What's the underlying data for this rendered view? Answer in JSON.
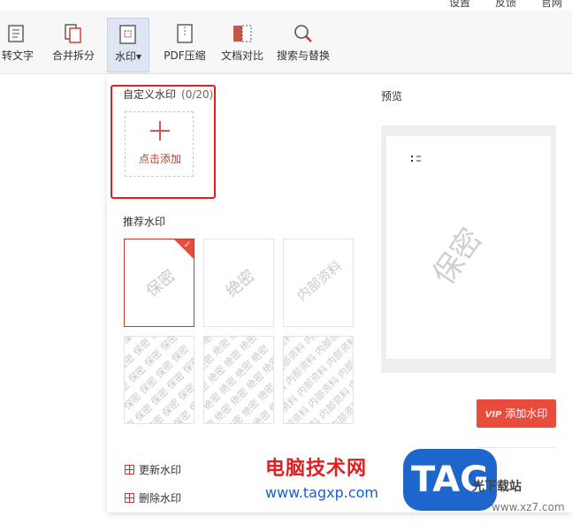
{
  "topbar": {
    "items": [
      "设置",
      "反馈",
      "官网"
    ]
  },
  "toolbar": {
    "items": [
      {
        "label": "转文字",
        "icon": "document-text-icon"
      },
      {
        "label": "合并拆分",
        "icon": "merge-split-icon"
      },
      {
        "label": "水印▾",
        "icon": "watermark-icon"
      },
      {
        "label": "PDF压缩",
        "icon": "compress-icon"
      },
      {
        "label": "文档对比",
        "icon": "compare-icon"
      },
      {
        "label": "搜索与替换",
        "icon": "search-icon"
      }
    ],
    "active_index": 2
  },
  "custom": {
    "title": "自定义水印",
    "count": "(0/20)",
    "add_label": "点击添加"
  },
  "recommended": {
    "title": "推荐水印",
    "tiles_single": [
      "保密",
      "绝密",
      "内部资料"
    ],
    "tiles_tiled": [
      "保密",
      "绝密",
      "内部资料"
    ]
  },
  "preview": {
    "title": "预览",
    "watermark": "保密"
  },
  "buttons": {
    "add_watermark": "添加水印",
    "vip": "VIP"
  },
  "actions": {
    "update": "更新水印",
    "delete": "删除水印"
  },
  "overlay": {
    "site_cn": "电脑技术网",
    "site_url": "www.tagxp.com",
    "tag": "TAG",
    "xz_cn": "光下载站",
    "xz_url": "www.xz7.com"
  },
  "colors": {
    "accent": "#e74c3c",
    "highlight": "#e02020"
  }
}
